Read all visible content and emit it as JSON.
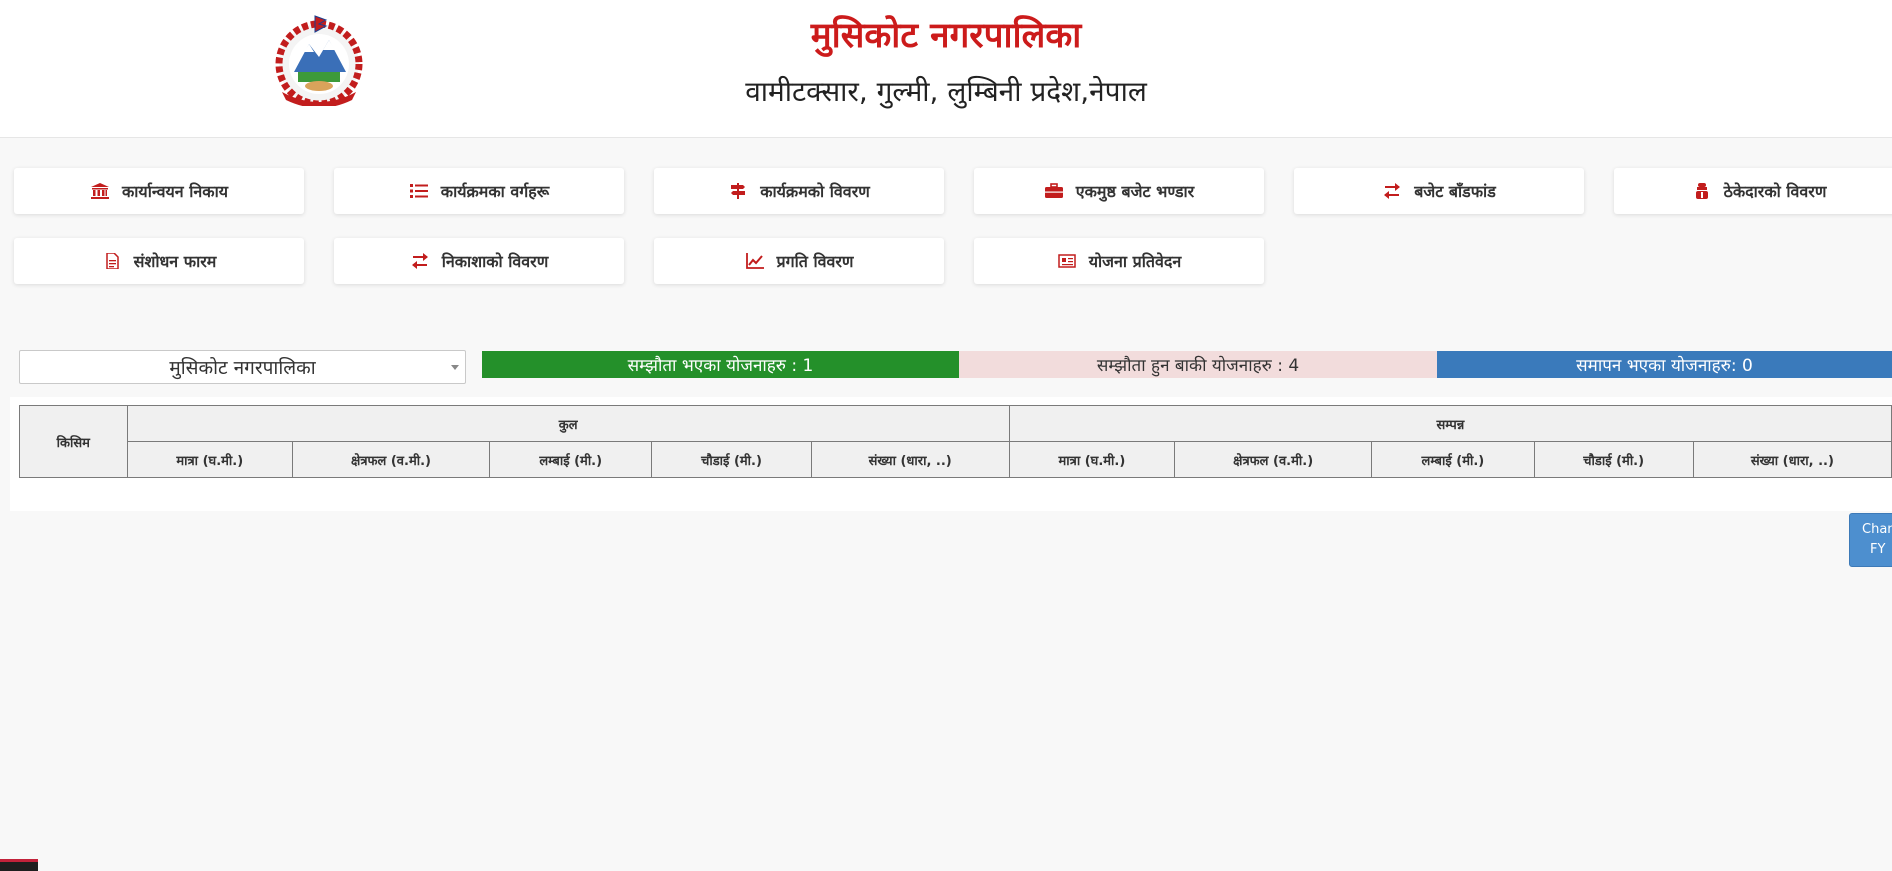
{
  "header": {
    "title": "मुसिकोट नगरपालिका",
    "subtitle": "वामीटक्सार, गुल्मी, लुम्बिनी प्रदेश,नेपाल",
    "emblem_icon": "nepal-government-emblem-icon"
  },
  "nav": {
    "items": [
      {
        "label": "कार्यान्वयन निकाय",
        "icon": "bank-icon"
      },
      {
        "label": "कार्यक्रमका वर्गहरू",
        "icon": "list-icon"
      },
      {
        "label": "कार्यक्रमको विवरण",
        "icon": "signpost-icon"
      },
      {
        "label": "एकमुष्ठ बजेट भण्डार",
        "icon": "briefcase-icon"
      },
      {
        "label": "बजेट बाँडफांड",
        "icon": "exchange-icon"
      },
      {
        "label": "ठेकेदारको विवरण",
        "icon": "contractor-icon"
      },
      {
        "label": "संशोधन फारम",
        "icon": "document-icon"
      },
      {
        "label": "निकाशाको विवरण",
        "icon": "exchange-icon"
      },
      {
        "label": "प्रगति विवरण",
        "icon": "line-chart-icon"
      },
      {
        "label": "योजना प्रतिवेदन",
        "icon": "newspaper-icon"
      }
    ]
  },
  "filter": {
    "selected": "मुसिकोट नगरपालिका"
  },
  "stats": {
    "agreed": "सम्झौता भएका योजनाहरु : 1",
    "pending": "सम्झौता हुन बाकी योजनाहरु : 4",
    "completed": "समापन भएका योजनाहरु: 0"
  },
  "table": {
    "type_header": "किसिम",
    "group_total": "कुल",
    "group_completed": "सम्पन्न",
    "columns": [
      "मात्रा (घ.मी.)",
      "क्षेत्रफल (व.मी.)",
      "लम्बाई (मी.)",
      "चौडाई (मी.)",
      "संख्या (धारा, ..)"
    ]
  },
  "fy_button": {
    "line1": "Change",
    "line2": "FY"
  },
  "colors": {
    "brand_red": "#cc1b1b",
    "green": "#24902a",
    "pink": "#f2dcdc",
    "blue": "#3a7abb"
  }
}
